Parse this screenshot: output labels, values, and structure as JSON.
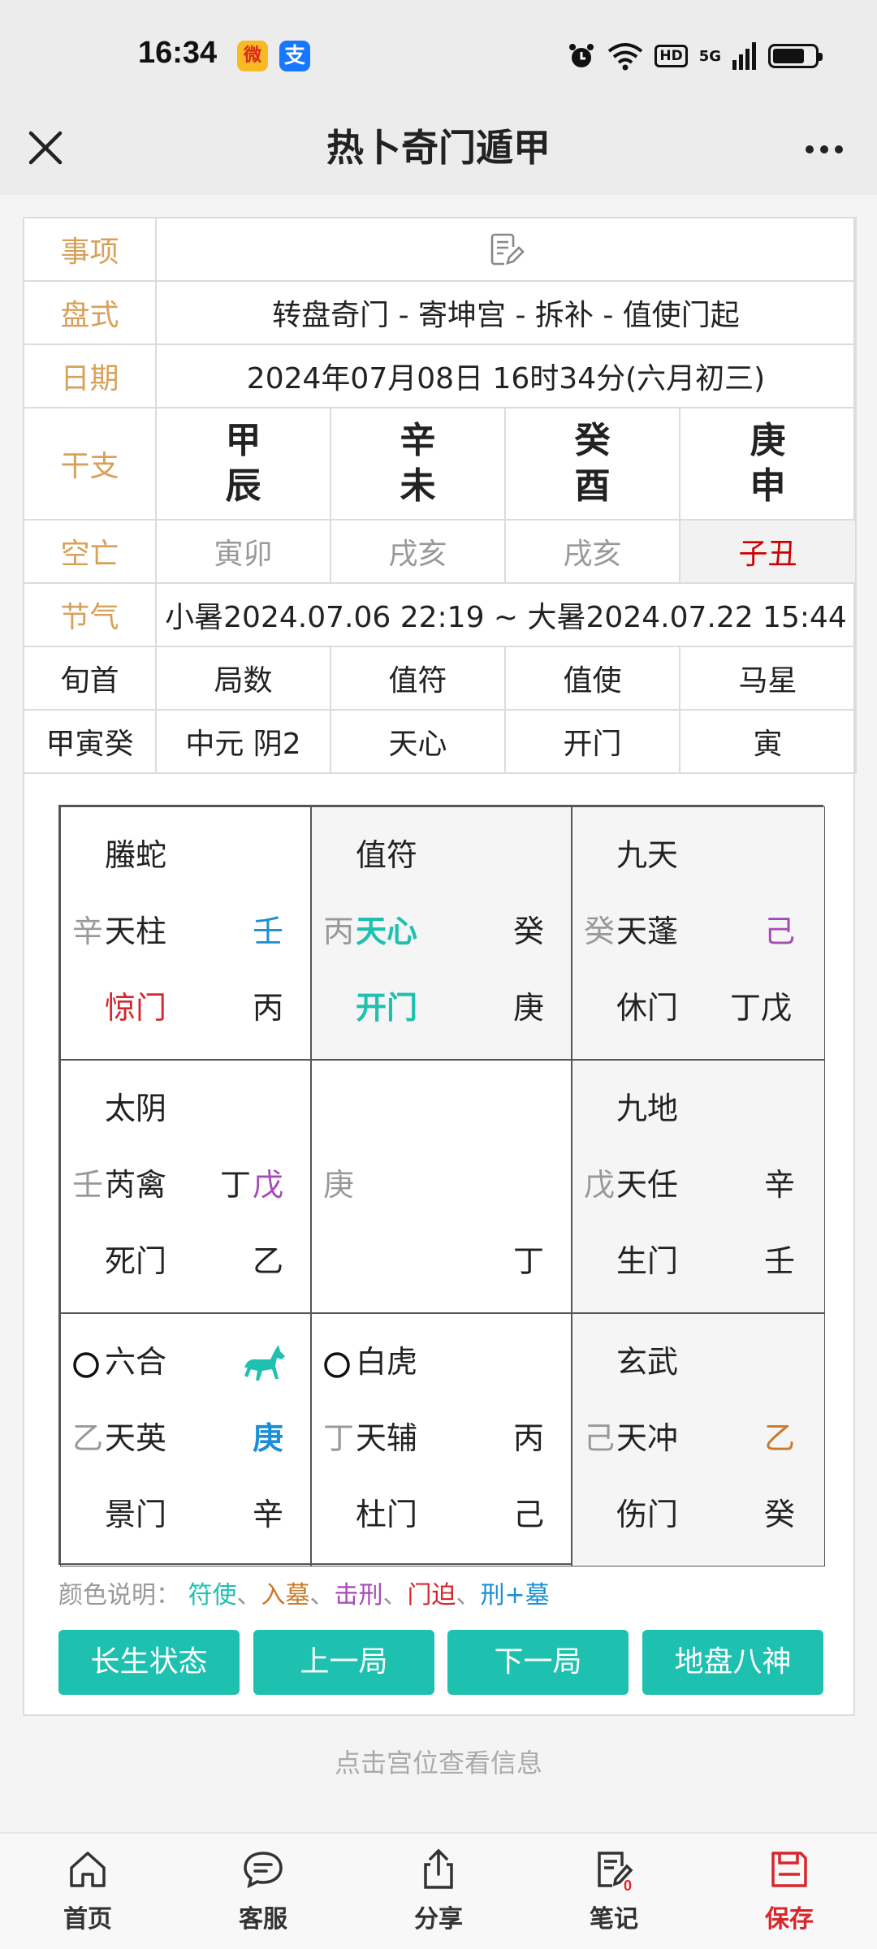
{
  "status_bar": {
    "time": "16:34",
    "weibo_icon": "微",
    "alipay_icon": "支",
    "hd": "HD",
    "network": "5G",
    "battery_level": 0.75
  },
  "header": {
    "title": "热卜奇门遁甲"
  },
  "info": {
    "labels": {
      "matter": "事项",
      "chart_type": "盘式",
      "date": "日期",
      "ganzhi": "干支",
      "void": "空亡",
      "solar_term": "节气",
      "xunshou": "旬首",
      "jushu": "局数",
      "zhifu": "值符",
      "zhishi": "值使",
      "maxing": "马星"
    },
    "chart_type": "转盘奇门 - 寄坤宫 - 拆补 - 值使门起",
    "date": "2024年07月08日 16时34分(六月初三)",
    "ganzhi": [
      {
        "top": "甲",
        "bottom": "辰"
      },
      {
        "top": "辛",
        "bottom": "未"
      },
      {
        "top": "癸",
        "bottom": "酉"
      },
      {
        "top": "庚",
        "bottom": "申"
      }
    ],
    "void": [
      "寅卯",
      "戌亥",
      "戌亥",
      "子丑"
    ],
    "solar_term": "小暑2024.07.06 22:19 ~ 大暑2024.07.22 15:44",
    "values": {
      "xunshou": "甲寅癸",
      "jushu": "中元 阴2",
      "zhifu": "天心",
      "zhishi": "开门",
      "maxing": "寅"
    }
  },
  "palaces": [
    {
      "god": "螣蛇",
      "heaven_stem_small": "辛",
      "star": "天柱",
      "star_right": "壬",
      "door": "惊门",
      "door_right": "丙"
    },
    {
      "god": "值符",
      "heaven_stem_small": "丙",
      "star": "天心",
      "star_right": "癸",
      "door": "开门",
      "door_right": "庚"
    },
    {
      "god": "九天",
      "heaven_stem_small": "癸",
      "star": "天蓬",
      "star_right": "己",
      "door": "休门",
      "door_right": "丁戊"
    },
    {
      "god": "太阴",
      "heaven_stem_small": "壬",
      "star": "芮禽",
      "star_right_a": "丁",
      "star_right_b": "戊",
      "door": "死门",
      "door_right": "乙"
    },
    {
      "center_small": "庚",
      "center_right": "丁"
    },
    {
      "god": "九地",
      "heaven_stem_small": "戊",
      "star": "天任",
      "star_right": "辛",
      "door": "生门",
      "door_right": "壬"
    },
    {
      "god": "六合",
      "heaven_stem_small": "乙",
      "star": "天英",
      "star_right": "庚",
      "door": "景门",
      "door_right": "辛"
    },
    {
      "god": "白虎",
      "heaven_stem_small": "丁",
      "star": "天辅",
      "star_right": "丙",
      "door": "杜门",
      "door_right": "己"
    },
    {
      "god": "玄武",
      "heaven_stem_small": "己",
      "star": "天冲",
      "star_right": "乙",
      "door": "伤门",
      "door_right": "癸"
    }
  ],
  "legend": {
    "prefix": "颜色说明：",
    "items": [
      "符使",
      "入墓",
      "击刑",
      "门迫",
      "刑+墓"
    ],
    "sep": "、",
    "colors": {
      "fushi": "#1ec0b0",
      "rumu": "#c97a2a",
      "jixing": "#a54bb6",
      "menpo": "#d7262c",
      "xingmu": "#1a8fd6"
    }
  },
  "buttons": [
    "长生状态",
    "上一局",
    "下一局",
    "地盘八神"
  ],
  "hint": "点击宫位查看信息",
  "nav": {
    "items": [
      "首页",
      "客服",
      "分享",
      "笔记",
      "保存"
    ],
    "notes_badge": "0"
  },
  "colors": {
    "accent": "#1ec0b0",
    "label_gold": "#d7a15b",
    "red": "#d7262c",
    "purple": "#a54bb6",
    "blue": "#1a8fd6",
    "orange": "#c97a2a"
  }
}
